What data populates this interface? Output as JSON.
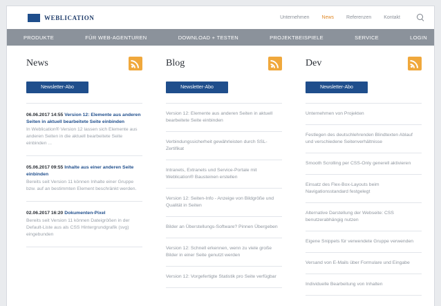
{
  "brand": {
    "name": "WEBLICATION"
  },
  "topnav": {
    "links": [
      "Unternehmen",
      "News",
      "Referenzen",
      "Kontakt"
    ],
    "active_index": 1
  },
  "mainnav": {
    "items": [
      "PRODUKTE",
      "FÜR WEB-AGENTUREN",
      "DOWNLOAD + TESTEN",
      "PROJEKTBEISPIELE",
      "SERVICE",
      "LOGIN"
    ]
  },
  "columns": {
    "news": {
      "title": "News",
      "button": "Newsletter-Abo",
      "items": [
        {
          "date": "06.06.2017 14:55",
          "title": "Version 12: Elemente aus anderen Seiten in aktuell bearbeitete Seite einbinden",
          "body": "In Weblication® Version 12 lassen sich Elemente aus anderen Seiten in die aktuell bearbeitete Seite einbinden ..."
        },
        {
          "date": "05.06.2017 09:55",
          "title": "Inhalte aus einer anderen Seite einbinden",
          "body": "Bereits seit Version 11 können Inhalte einer Gruppe bzw. auf an bestimmten Element beschränkt werden."
        },
        {
          "date": "02.06.2017 16:20",
          "title": "Dokumenten-Pixel",
          "body": "Bereits seit Version 11 können Dateigrößen in der Default-Liste aus als CSS Hintergrundgrafik (svg) eingebunden"
        }
      ]
    },
    "blog": {
      "title": "Blog",
      "button": "Newsletter-Abo",
      "items": [
        "Version 12: Elemente aus anderen Seiten in aktuell bearbeitete Seite einbinden",
        "Verbindungssicherheit gewährleisten durch SSL-Zertifikat",
        "Intranets, Extranets und Service-Portale mit Weblication® Bausteinen erstellen",
        "Version 12: Seiten-Info - Anzeige von Bildgröße und Qualität in Seiten",
        "Bilder an Überstellungs-Software? Pinnen Übergeben",
        "Version 12: Schnell erkennen, wenn zu viele große Bilder in einer Seite genutzt werden",
        "Version 12: Vorgefertigte Statistik pro Seite verfügbar"
      ]
    },
    "dev": {
      "title": "Dev",
      "button": "Newsletter-Abo",
      "items": [
        "Unternehmen von Projekten",
        "Festlegen des deutschlehrenden Blindtexten Ablauf und verschiedene Seitenverhältnisse",
        "Smooth Scrolling per CSS-Only generell aktivieren",
        "Einsatz des Flex-Box-Layouts beim Navigationsstandard festgelegt",
        "Alternative Darstellung der Webseite: CSS benutzerabhängig nutzen",
        "Eigene Snippets für verwendete Gruppe verwenden",
        "Versand von E-Mails über Formulare und Eingabe",
        "Individuelle Bearbeitung von Inhalten"
      ]
    }
  },
  "colors": {
    "brand": "#1f4e8c",
    "nav_bg": "#8b929b",
    "rss": "#f0a83c",
    "active_link": "#e08a2a"
  },
  "icons": [
    "search-icon",
    "rss-icon"
  ]
}
